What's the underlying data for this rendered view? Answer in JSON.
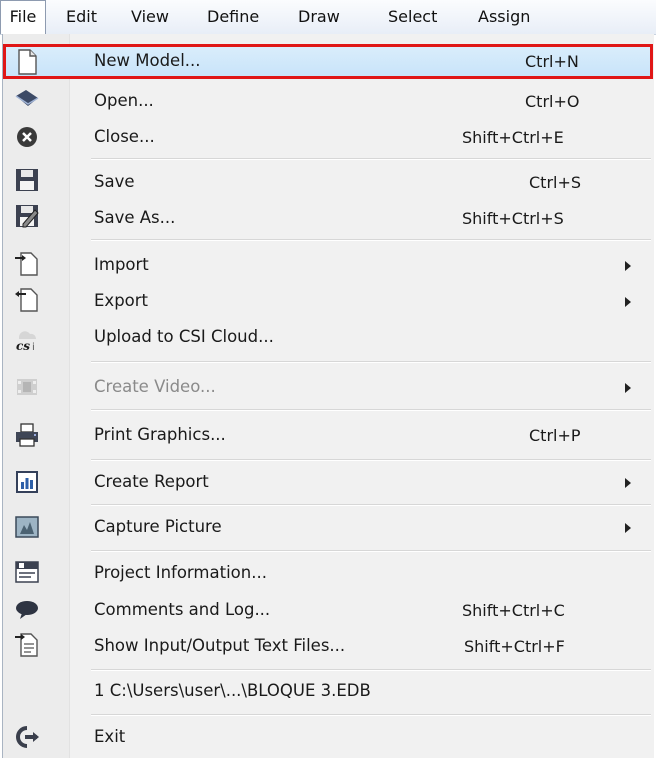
{
  "menubar": {
    "items": [
      "File",
      "Edit",
      "View",
      "Define",
      "Draw",
      "Select",
      "Assign"
    ]
  },
  "file_menu": {
    "items": [
      {
        "label": "New Model...",
        "shortcut": "Ctrl+N",
        "icon": "new-page-icon"
      },
      {
        "label": "Open...",
        "shortcut": "Ctrl+O",
        "icon": "open-icon"
      },
      {
        "label": "Close...",
        "shortcut": "Shift+Ctrl+E",
        "icon": "close-icon"
      },
      {
        "label": "Save",
        "shortcut": "Ctrl+S",
        "icon": "save-icon"
      },
      {
        "label": "Save As...",
        "shortcut": "Shift+Ctrl+S",
        "icon": "save-as-icon"
      },
      {
        "label": "Import",
        "shortcut": "",
        "icon": "import-icon"
      },
      {
        "label": "Export",
        "shortcut": "",
        "icon": "export-icon"
      },
      {
        "label": "Upload to CSI Cloud...",
        "shortcut": "",
        "icon": "csi-cloud-icon"
      },
      {
        "label": "Create Video...",
        "shortcut": "",
        "icon": "film-icon"
      },
      {
        "label": "Print Graphics...",
        "shortcut": "Ctrl+P",
        "icon": "printer-icon"
      },
      {
        "label": "Create Report",
        "shortcut": "",
        "icon": "report-icon"
      },
      {
        "label": "Capture Picture",
        "shortcut": "",
        "icon": "picture-icon"
      },
      {
        "label": "Project Information...",
        "shortcut": "",
        "icon": "project-info-icon"
      },
      {
        "label": "Comments and Log...",
        "shortcut": "Shift+Ctrl+C",
        "icon": "comment-icon"
      },
      {
        "label": "Show Input/Output Text Files...",
        "shortcut": "Shift+Ctrl+F",
        "icon": "text-files-icon"
      },
      {
        "label": "1 C:\\Users\\user\\...\\BLOQUE 3.EDB",
        "shortcut": "",
        "icon": ""
      },
      {
        "label": "Exit",
        "shortcut": "",
        "icon": "exit-icon"
      }
    ]
  },
  "colors": {
    "highlight_fill": "#c7e3f9",
    "highlight_outline": "#e01616",
    "disabled_text": "#8a8a8a"
  }
}
